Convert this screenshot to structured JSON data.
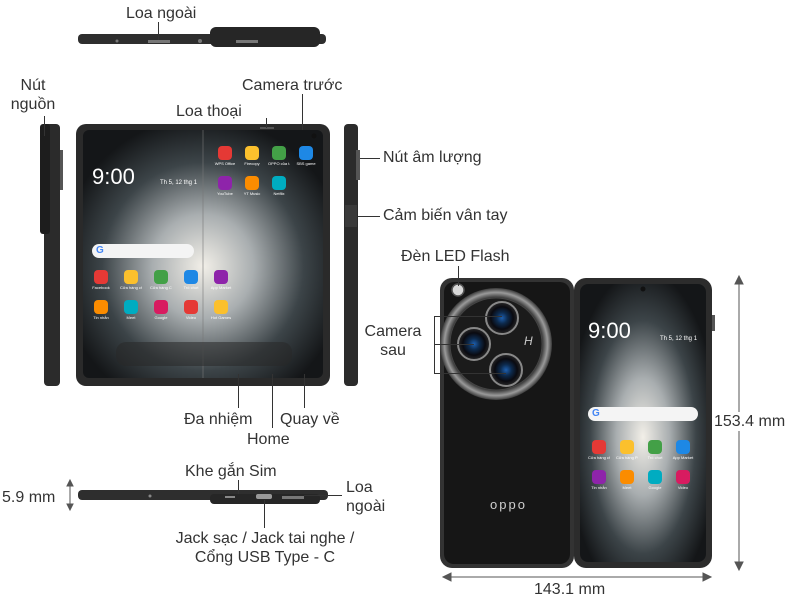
{
  "labels": {
    "loa_ngoai_top": "Loa ngoài",
    "nut_nguon": "Nút\nnguồn",
    "camera_truoc": "Camera trước",
    "loa_thoai": "Loa thoại",
    "nut_am_luong": "Nút âm lượng",
    "cam_bien_van_tay": "Cảm biến vân tay",
    "den_led_flash": "Đèn LED Flash",
    "camera_sau": "Camera\nsau",
    "da_nhiem": "Đa nhiệm",
    "quay_ve": "Quay về",
    "home": "Home",
    "khe_gan_sim": "Khe gắn Sim",
    "loa_ngoai_bottom": "Loa\nngoài",
    "jack": "Jack sạc / Jack tai nghe /\nCổng USB Type - C"
  },
  "dimensions": {
    "thickness": "5.9 mm",
    "height": "153.4 mm",
    "width": "143.1 mm"
  },
  "phone": {
    "clock_inner": "9:00",
    "clock_cover": "9:00",
    "date": "Th 5, 12 thg 1",
    "brand": "oppo",
    "hasselblad_mark": "H",
    "search_logo": "G",
    "inner_apps": [
      "WPS Office",
      "Firecopy",
      "OPPO của t...",
      "SBS game",
      "YouTube",
      "YT Music",
      "Netflix",
      "Facebook",
      "Cửa hàng ch...",
      "Cửa hàng CH",
      "Trò chơi",
      "App Market",
      "Tin nhắn",
      "Meet",
      "Google",
      "Video",
      "Hot Games"
    ],
    "cover_apps": [
      "Cửa hàng ch...",
      "Cửa hàng Pl...",
      "Trò chơi",
      "App Market",
      "Tin nhắn",
      "Meet",
      "Google",
      "Video"
    ]
  },
  "colors": {
    "frame": "#2c2c2c",
    "body_dark": "#1c1c1c",
    "leather": "#151515",
    "label_text": "#333333",
    "line": "#333333"
  }
}
